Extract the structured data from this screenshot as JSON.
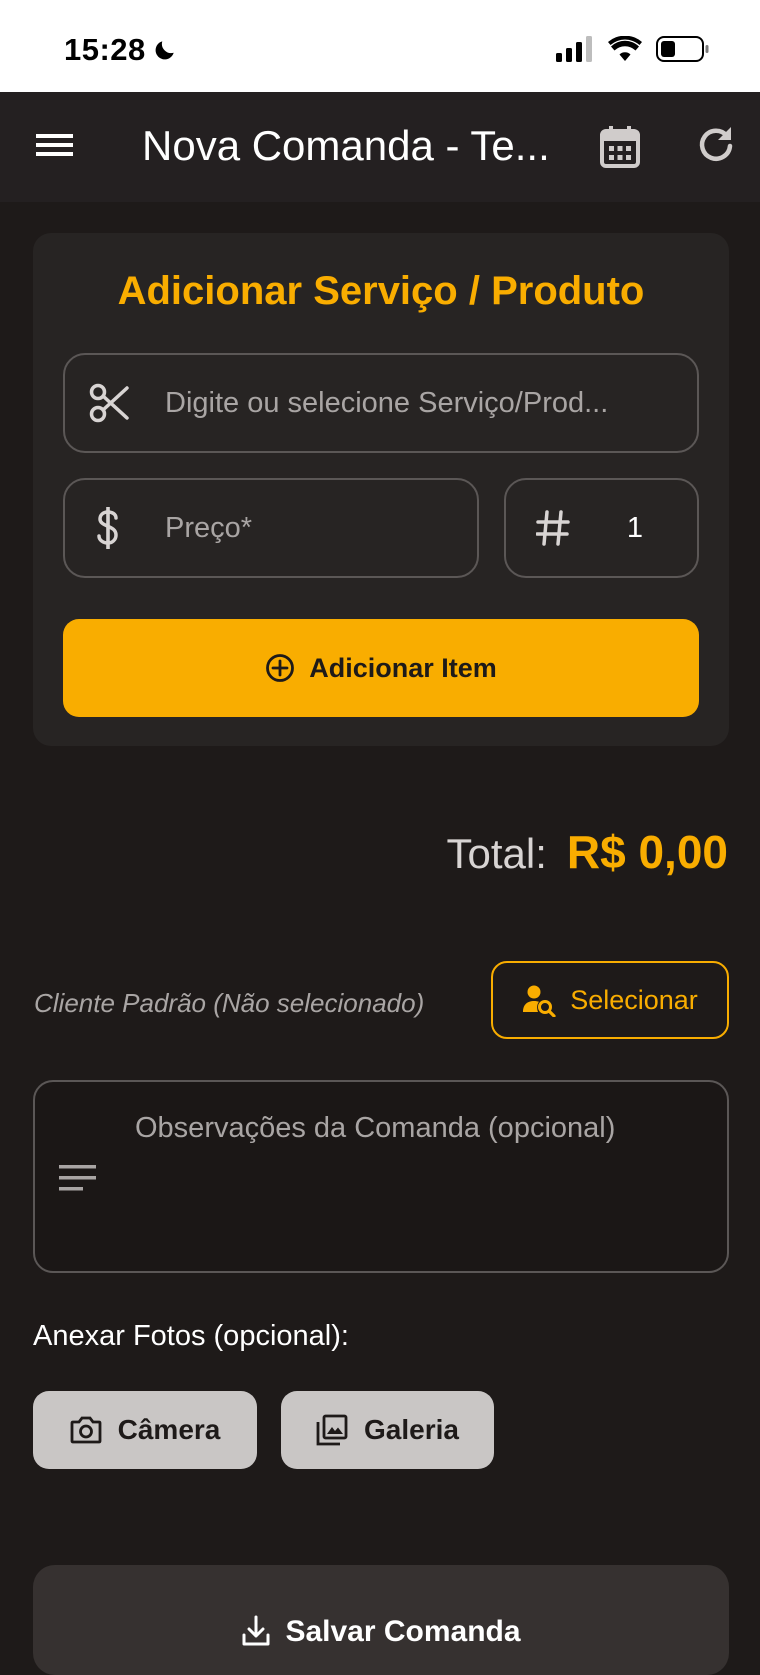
{
  "status_bar": {
    "time": "15:28"
  },
  "app_bar": {
    "title": "Nova Comanda - Te..."
  },
  "add_card": {
    "title": "Adicionar Serviço / Produto",
    "service_placeholder": "Digite ou selecione Serviço/Prod...",
    "price_placeholder": "Preço*",
    "quantity_value": "1",
    "add_button_label": "Adicionar Item"
  },
  "total": {
    "label": "Total:",
    "value": "R$ 0,00"
  },
  "client": {
    "text": "Cliente Padrão (Não selecionado)",
    "select_label": "Selecionar"
  },
  "notes": {
    "placeholder": "Observações da Comanda (opcional)"
  },
  "attachments": {
    "label": "Anexar Fotos (opcional):",
    "camera_label": "Câmera",
    "gallery_label": "Galeria"
  },
  "save": {
    "label": "Salvar Comanda"
  },
  "colors": {
    "accent": "#f9ad00",
    "background": "#1e1a19",
    "card": "#272423"
  }
}
